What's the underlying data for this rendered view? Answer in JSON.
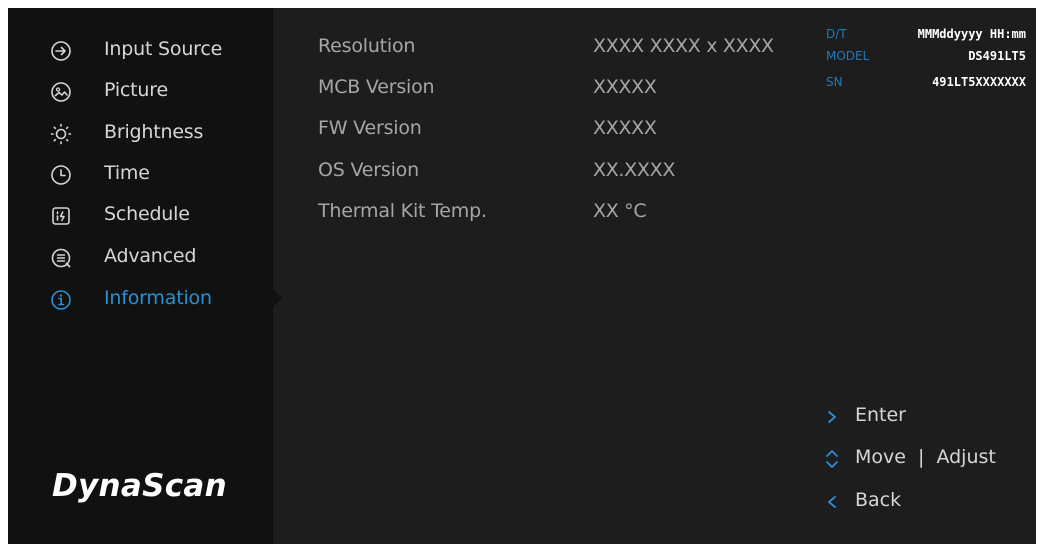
{
  "menu": {
    "items": [
      {
        "label": "Input Source",
        "icon": "input-source-icon"
      },
      {
        "label": "Picture",
        "icon": "picture-icon"
      },
      {
        "label": "Brightness",
        "icon": "brightness-icon"
      },
      {
        "label": "Time",
        "icon": "clock-icon"
      },
      {
        "label": "Schedule",
        "icon": "schedule-icon"
      },
      {
        "label": "Advanced",
        "icon": "advanced-icon"
      },
      {
        "label": "Information",
        "icon": "info-icon"
      }
    ],
    "selected": "Information"
  },
  "brand": {
    "logo_text": "DynaScan"
  },
  "information": {
    "rows": [
      {
        "label": "Resolution",
        "value": "XXXX  XXXX x XXXX"
      },
      {
        "label": "MCB Version",
        "value": "XXXXX"
      },
      {
        "label": "FW Version",
        "value": "XXXXX"
      },
      {
        "label": "OS Version",
        "value": "XX.XXXX"
      },
      {
        "label": "Thermal Kit Temp.",
        "value": "XX °C"
      }
    ]
  },
  "device_meta": {
    "dt_label": "D/T",
    "dt_value": "MMMddyyyy HH:mm",
    "model_label": "MODEL",
    "model_value": "DS491LT5",
    "sn_label": "SN",
    "sn_value": "491LT5XXXXXXX"
  },
  "hints": {
    "enter_label": "Enter",
    "move_label": "Move",
    "separator": "|",
    "adjust_label": "Adjust",
    "back_label": "Back"
  },
  "colors": {
    "accent": "#2a8fd3",
    "sidebar_bg": "#111111",
    "panel_bg": "#1d1d1d",
    "text_primary": "#d6d6d6",
    "text_secondary": "#a6a6a6"
  }
}
